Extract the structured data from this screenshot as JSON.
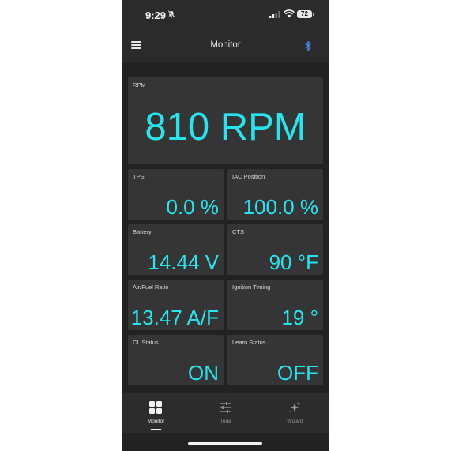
{
  "status_bar": {
    "time": "9:29",
    "battery": "72"
  },
  "header": {
    "title": "Monitor"
  },
  "colors": {
    "accent": "#26e5ee",
    "background": "#222222",
    "card": "#353535",
    "bluetooth": "#4a8df0"
  },
  "cards": {
    "rpm": {
      "label": "RPM",
      "value": "810 RPM"
    },
    "tps": {
      "label": "TPS",
      "value": "0.0 %"
    },
    "iac": {
      "label": "IAC Position",
      "value": "100.0 %"
    },
    "battery": {
      "label": "Battery",
      "value": "14.44 V"
    },
    "cts": {
      "label": "CTS",
      "value": "90 °F"
    },
    "afr": {
      "label": "Air/Fuel Ratio",
      "value": "13.47 A/F"
    },
    "timing": {
      "label": "Ignition Timing",
      "value": "19 °"
    },
    "cl_status": {
      "label": "CL Status",
      "value": "ON"
    },
    "learn_status": {
      "label": "Learn Status",
      "value": "OFF"
    }
  },
  "nav": {
    "monitor": {
      "label": "Monitor",
      "icon": "grid-icon",
      "active": true
    },
    "tune": {
      "label": "Tune",
      "icon": "sliders-icon"
    },
    "wizard": {
      "label": "Wizard",
      "icon": "sparkle-icon"
    }
  }
}
